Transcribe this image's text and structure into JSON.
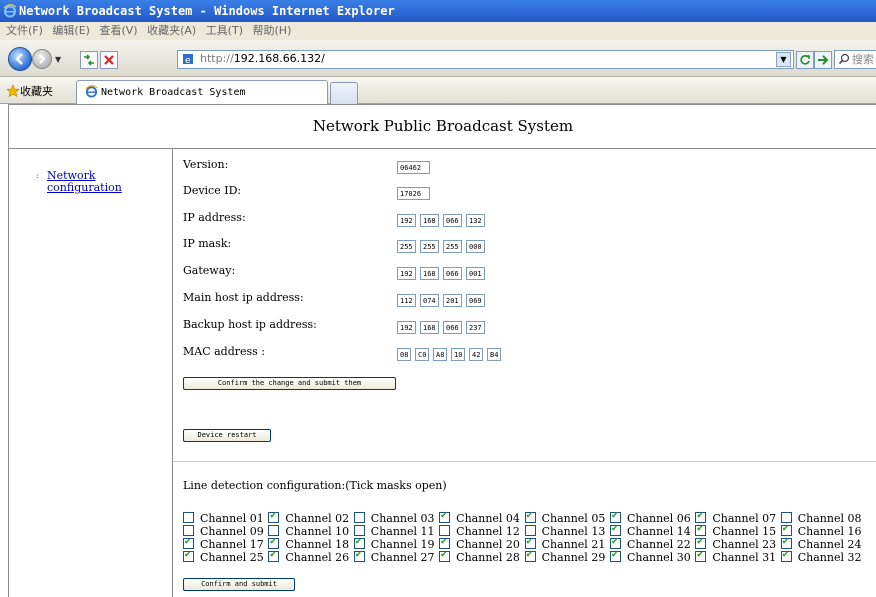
{
  "window": {
    "title": "Network Broadcast System - Windows Internet Explorer"
  },
  "menubar": {
    "items": [
      "文件(F)",
      "编辑(E)",
      "查看(V)",
      "收藏夹(A)",
      "工具(T)",
      "帮助(H)"
    ]
  },
  "address": {
    "protocol": "http://",
    "host": "192.168.66.132/",
    "search_placeholder": "搜索"
  },
  "favorites": {
    "label": "收藏夹",
    "tab_title": "Network Broadcast System"
  },
  "page": {
    "title": "Network Public Broadcast System",
    "nav": {
      "link": "Network configuration",
      "link_line1": "Network",
      "link_line2": "configuration"
    },
    "config": {
      "version_label": "Version:",
      "version": "06462",
      "device_label": "Device ID:",
      "device": "17026",
      "ip_label": "IP address:",
      "ip": [
        "192",
        "168",
        "066",
        "132"
      ],
      "mask_label": "IP mask:",
      "mask": [
        "255",
        "255",
        "255",
        "000"
      ],
      "gateway_label": "Gateway:",
      "gateway": [
        "192",
        "168",
        "066",
        "001"
      ],
      "main_host_label": "Main host ip address:",
      "main_host": [
        "112",
        "074",
        "201",
        "069"
      ],
      "backup_host_label": "Backup host ip address:",
      "backup_host": [
        "192",
        "168",
        "066",
        "237"
      ],
      "mac_label": "MAC address :",
      "mac": [
        "08",
        "C0",
        "A8",
        "10",
        "42",
        "B4"
      ],
      "confirm_label": "Confirm the change and submit them",
      "restart_label": "Device restart"
    },
    "line_detection": {
      "heading": "Line detection configuration:(Tick masks open)",
      "channels": [
        {
          "label": "Channel 01",
          "checked": false
        },
        {
          "label": "Channel 02",
          "checked": true
        },
        {
          "label": "Channel 03",
          "checked": false
        },
        {
          "label": "Channel 04",
          "checked": true
        },
        {
          "label": "Channel 05",
          "checked": true
        },
        {
          "label": "Channel 06",
          "checked": true
        },
        {
          "label": "Channel 07",
          "checked": true
        },
        {
          "label": "Channel 08",
          "checked": false
        },
        {
          "label": "Channel 09",
          "checked": false
        },
        {
          "label": "Channel 10",
          "checked": false
        },
        {
          "label": "Channel 11",
          "checked": false
        },
        {
          "label": "Channel 12",
          "checked": false
        },
        {
          "label": "Channel 13",
          "checked": false
        },
        {
          "label": "Channel 14",
          "checked": true
        },
        {
          "label": "Channel 15",
          "checked": true
        },
        {
          "label": "Channel 16",
          "checked": true
        },
        {
          "label": "Channel 17",
          "checked": true
        },
        {
          "label": "Channel 18",
          "checked": true
        },
        {
          "label": "Channel 19",
          "checked": true
        },
        {
          "label": "Channel 20",
          "checked": true
        },
        {
          "label": "Channel 21",
          "checked": true
        },
        {
          "label": "Channel 22",
          "checked": true
        },
        {
          "label": "Channel 23",
          "checked": true
        },
        {
          "label": "Channel 24",
          "checked": true
        },
        {
          "label": "Channel 25",
          "checked": true
        },
        {
          "label": "Channel 26",
          "checked": true
        },
        {
          "label": "Channel 27",
          "checked": true
        },
        {
          "label": "Channel 28",
          "checked": true
        },
        {
          "label": "Channel 29",
          "checked": true
        },
        {
          "label": "Channel 30",
          "checked": true
        },
        {
          "label": "Channel 31",
          "checked": true
        },
        {
          "label": "Channel 32",
          "checked": true
        }
      ],
      "submit_label": "Confirm and submit"
    }
  }
}
